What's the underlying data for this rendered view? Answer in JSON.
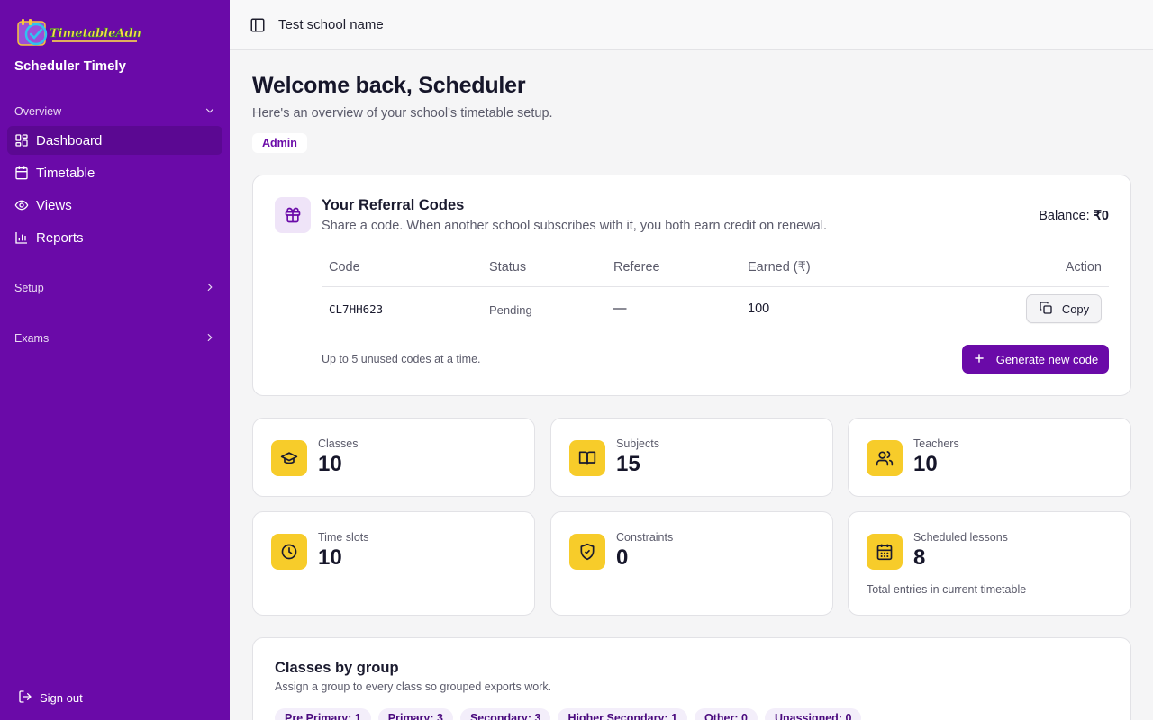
{
  "sidebar": {
    "brand_name": "Scheduler Timely",
    "groups": {
      "overview": "Overview",
      "setup": "Setup",
      "exams": "Exams"
    },
    "items": [
      {
        "label": "Dashboard",
        "icon": "dashboard-icon",
        "active": true
      },
      {
        "label": "Timetable",
        "icon": "calendar-icon",
        "active": false
      },
      {
        "label": "Views",
        "icon": "eye-icon",
        "active": false
      },
      {
        "label": "Reports",
        "icon": "bar-chart-icon",
        "active": false
      }
    ],
    "sign_out": "Sign out",
    "colors": {
      "background": "#6a0aa8",
      "active": "#5b0892"
    }
  },
  "topbar": {
    "school_name": "Test school name"
  },
  "main": {
    "welcome": "Welcome back, Scheduler",
    "subtitle": "Here's an overview of your school's timetable setup.",
    "role_badge": "Admin"
  },
  "referral": {
    "title": "Your Referral Codes",
    "description": "Share a code. When another school subscribes with it, you both earn credit on renewal.",
    "balance_label": "Balance:",
    "balance_value": "₹0",
    "columns": [
      "Code",
      "Status",
      "Referee",
      "Earned (₹)",
      "Action"
    ],
    "rows": [
      {
        "code": "CL7HH623",
        "status": "Pending",
        "referee": "—",
        "earned": "100",
        "action": "Copy"
      }
    ],
    "note": "Up to 5 unused codes at a time.",
    "generate_button": "Generate new code"
  },
  "stats": [
    {
      "label": "Classes",
      "value": "10",
      "icon": "graduation-cap-icon"
    },
    {
      "label": "Subjects",
      "value": "15",
      "icon": "book-open-icon"
    },
    {
      "label": "Teachers",
      "value": "10",
      "icon": "users-icon"
    },
    {
      "label": "Time slots",
      "value": "10",
      "icon": "clock-icon"
    },
    {
      "label": "Constraints",
      "value": "0",
      "icon": "shield-check-icon"
    },
    {
      "label": "Scheduled lessons",
      "value": "8",
      "icon": "calendar-grid-icon",
      "note": "Total entries in current timetable"
    }
  ],
  "groups_card": {
    "title": "Classes by group",
    "description": "Assign a group to every class so grouped exports work.",
    "chips": [
      "Pre Primary: 1",
      "Primary: 3",
      "Secondary: 3",
      "Higher Secondary: 1",
      "Other: 0",
      "Unassigned: 0"
    ]
  },
  "colors": {
    "accent": "#6a0aa8",
    "stat_icon_bg": "#f7cc2a",
    "gift_bg": "#efe4f8"
  }
}
